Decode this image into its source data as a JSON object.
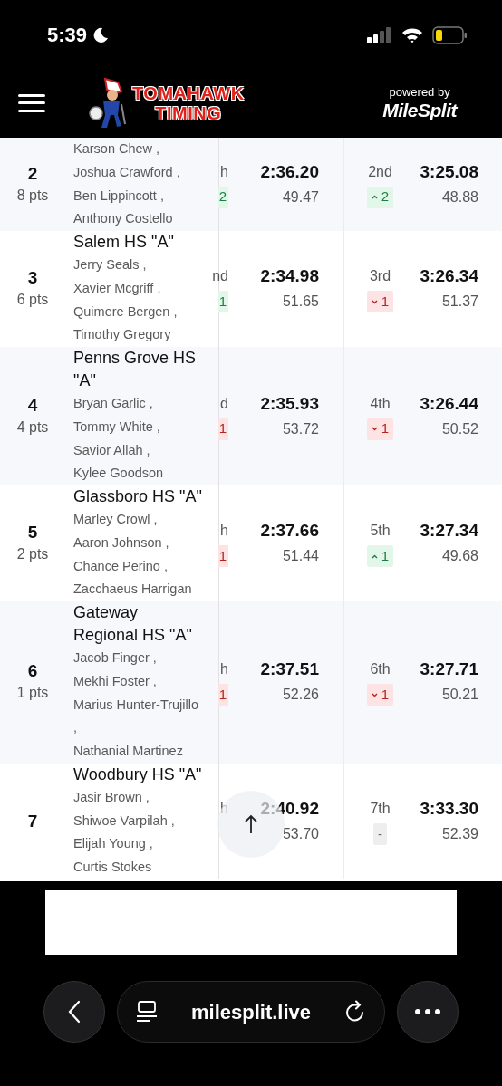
{
  "status_bar": {
    "time": "5:39"
  },
  "header": {
    "brand_line1": "TOMAHAWK",
    "brand_line2": "TIMING",
    "powered_by": "powered by",
    "partner": "MileSplit"
  },
  "rows": [
    {
      "rank": "2",
      "points": "8 pts",
      "runners": [
        "Karson Chew ,",
        "Joshua Crawford ,",
        "Ben Lippincott ,",
        "Anthony Costello"
      ],
      "prev": {
        "place": "h",
        "change": {
          "kind": "up",
          "text": "2"
        }
      },
      "split1": {
        "time": "2:36.20",
        "lap": "49.47"
      },
      "split2": {
        "place": "2nd",
        "change": {
          "kind": "up",
          "text": "2"
        },
        "time": "3:25.08",
        "lap": "48.88"
      }
    },
    {
      "rank": "3",
      "points": "6 pts",
      "team": "Salem HS \"A\"",
      "runners": [
        "Jerry Seals ,",
        "Xavier Mcgriff ,",
        "Quimere Bergen ,",
        "Timothy Gregory"
      ],
      "prev": {
        "place": "nd",
        "change": {
          "kind": "up",
          "text": "1"
        }
      },
      "split1": {
        "time": "2:34.98",
        "lap": "51.65"
      },
      "split2": {
        "place": "3rd",
        "change": {
          "kind": "down",
          "text": "1"
        },
        "time": "3:26.34",
        "lap": "51.37"
      }
    },
    {
      "rank": "4",
      "points": "4 pts",
      "team": "Penns Grove HS \"A\"",
      "runners": [
        "Bryan Garlic ,",
        "Tommy White ,",
        "Savior Allah ,",
        "Kylee Goodson"
      ],
      "prev": {
        "place": "d",
        "change": {
          "kind": "down",
          "text": "1"
        }
      },
      "split1": {
        "time": "2:35.93",
        "lap": "53.72"
      },
      "split2": {
        "place": "4th",
        "change": {
          "kind": "down",
          "text": "1"
        },
        "time": "3:26.44",
        "lap": "50.52"
      }
    },
    {
      "rank": "5",
      "points": "2 pts",
      "team": "Glassboro HS \"A\"",
      "runners": [
        "Marley Crowl ,",
        "Aaron Johnson ,",
        "Chance Perino ,",
        "Zacchaeus Harrigan"
      ],
      "prev": {
        "place": "h",
        "change": {
          "kind": "down",
          "text": "1"
        }
      },
      "split1": {
        "time": "2:37.66",
        "lap": "51.44"
      },
      "split2": {
        "place": "5th",
        "change": {
          "kind": "up",
          "text": "1"
        },
        "time": "3:27.34",
        "lap": "49.68"
      }
    },
    {
      "rank": "6",
      "points": "1 pts",
      "team": "Gateway Regional HS \"A\"",
      "runners": [
        "Jacob Finger ,",
        "Mekhi Foster ,",
        "Marius Hunter-Trujillo ,",
        "Nathanial Martinez"
      ],
      "prev": {
        "place": "h",
        "change": {
          "kind": "down",
          "text": "1"
        }
      },
      "split1": {
        "time": "2:37.51",
        "lap": "52.26"
      },
      "split2": {
        "place": "6th",
        "change": {
          "kind": "down",
          "text": "1"
        },
        "time": "3:27.71",
        "lap": "50.21"
      }
    },
    {
      "rank": "7",
      "team": "Woodbury HS \"A\"",
      "runners": [
        "Jasir Brown ,",
        "Shiwoe Varpilah ,",
        "Elijah Young ,",
        "Curtis Stokes"
      ],
      "prev": {
        "place": "h"
      },
      "split1": {
        "time": "2:40.92",
        "lap": "53.70"
      },
      "split2": {
        "place": "7th",
        "change": {
          "kind": "none",
          "text": "-"
        },
        "time": "3:33.30",
        "lap": "52.39"
      }
    }
  ],
  "browser": {
    "url": "milesplit.live"
  }
}
